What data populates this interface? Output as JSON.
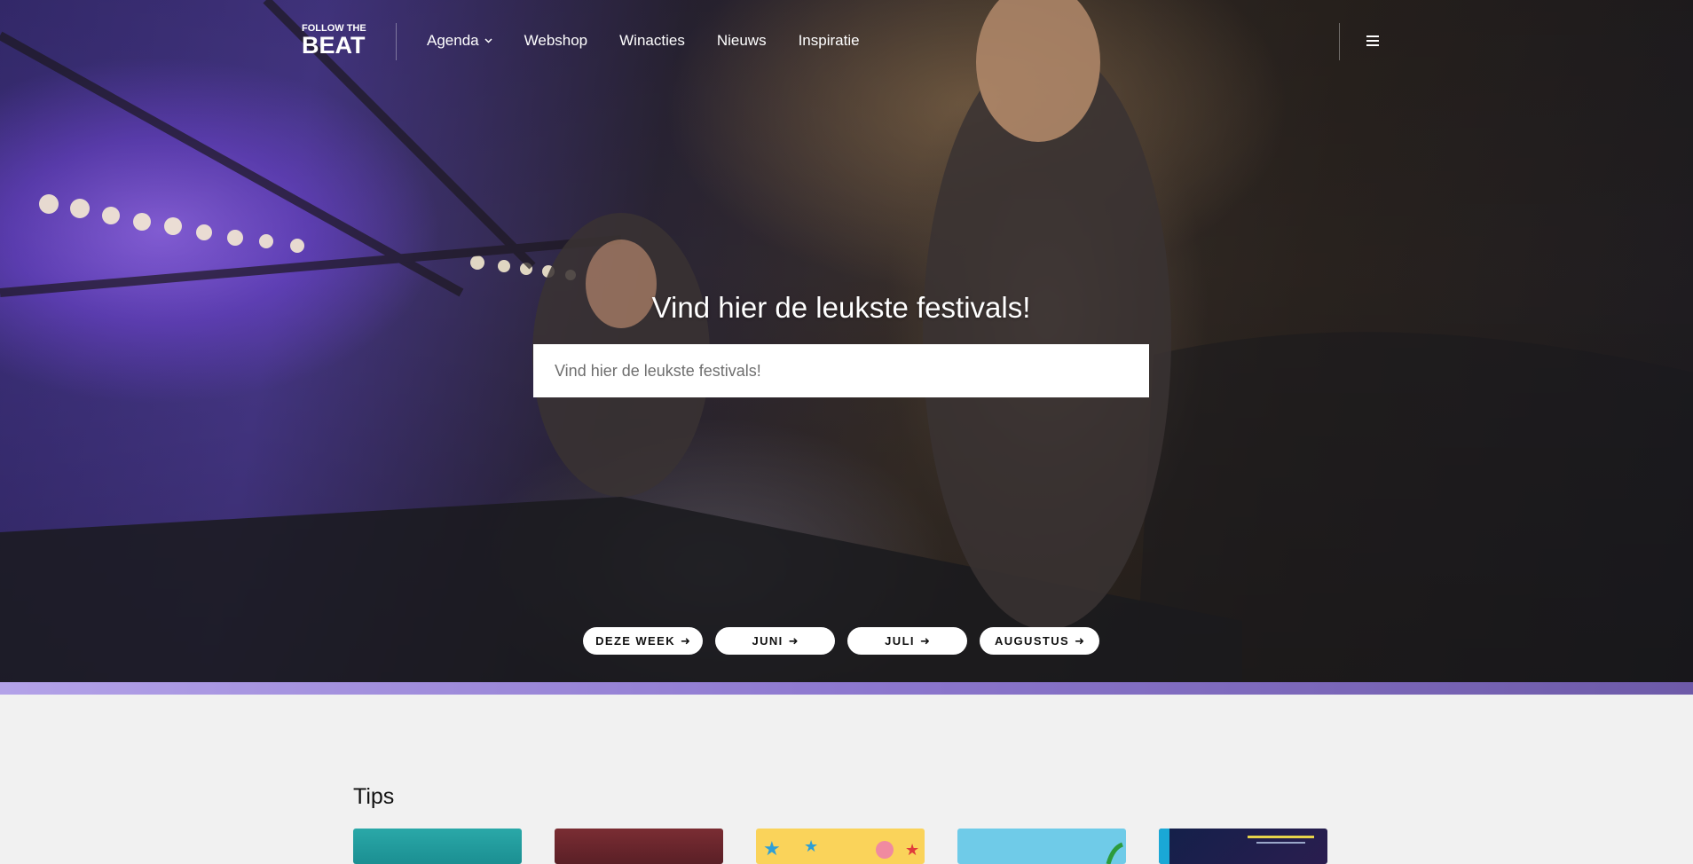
{
  "nav": {
    "logo_top": "FOLLOW THE",
    "logo_main": "BEAT",
    "links": [
      "Agenda",
      "Webshop",
      "Winacties",
      "Nieuws",
      "Inspiratie"
    ]
  },
  "hero": {
    "title": "Vind hier de leukste festivals!",
    "search_placeholder": "Vind hier de leukste festivals!"
  },
  "periods": [
    "DEZE WEEK",
    "JUNI",
    "JULI",
    "AUGUSTUS"
  ],
  "tips": {
    "title": "Tips"
  },
  "colors": {
    "accent_strip": "#8d78cf",
    "page_bg": "#f1f1f1"
  }
}
